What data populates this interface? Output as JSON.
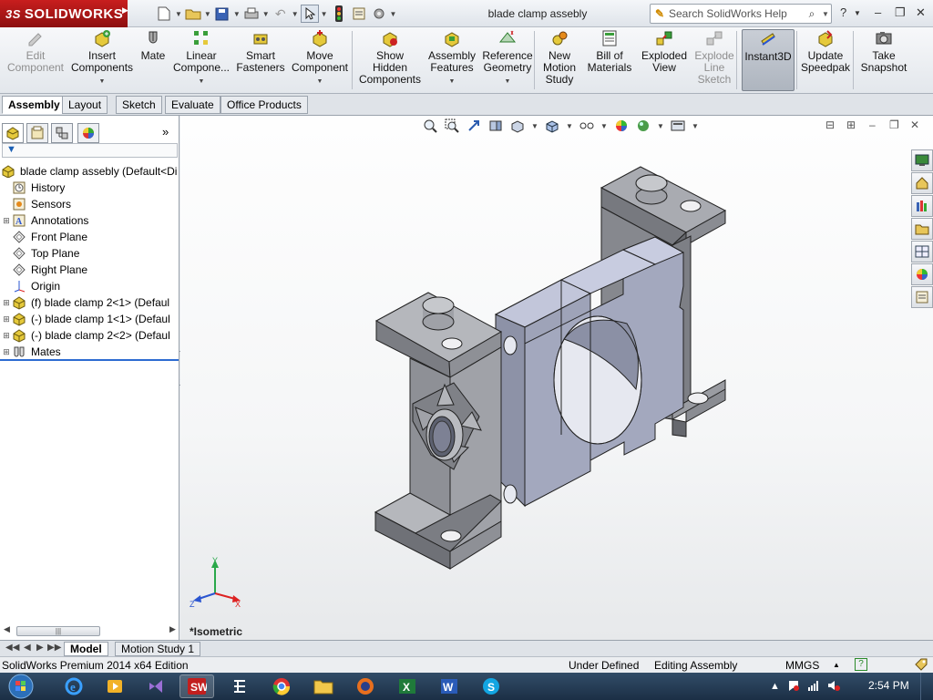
{
  "app": {
    "brand": "SOLIDWORKS",
    "brand_prefix": "3S",
    "document_title": "blade clamp assebly"
  },
  "search": {
    "placeholder": "Search SolidWorks Help"
  },
  "commands": [
    {
      "label": "Edit Component",
      "line1": "Edit",
      "line2": "Component",
      "disabled": true
    },
    {
      "label": "Insert Components",
      "line1": "Insert",
      "line2": "Components",
      "arrow": true
    },
    {
      "label": "Mate",
      "line1": "Mate",
      "line2": ""
    },
    {
      "label": "Linear Component Pattern",
      "line1": "Linear",
      "line2": "Compone...",
      "arrow": true
    },
    {
      "label": "Smart Fasteners",
      "line1": "Smart",
      "line2": "Fasteners"
    },
    {
      "label": "Move Component",
      "line1": "Move",
      "line2": "Component",
      "arrow": true
    },
    {
      "label": "Show Hidden Components",
      "line1": "Show",
      "line2": "Hidden",
      "line3": "Components"
    },
    {
      "label": "Assembly Features",
      "line1": "Assembly",
      "line2": "Features",
      "arrow": true
    },
    {
      "label": "Reference Geometry",
      "line1": "Reference",
      "line2": "Geometry",
      "arrow": true
    },
    {
      "label": "New Motion Study",
      "line1": "New",
      "line2": "Motion",
      "line3": "Study"
    },
    {
      "label": "Bill of Materials",
      "line1": "Bill of",
      "line2": "Materials"
    },
    {
      "label": "Exploded View",
      "line1": "Exploded",
      "line2": "View"
    },
    {
      "label": "Explode Line Sketch",
      "line1": "Explode",
      "line2": "Line",
      "line3": "Sketch",
      "disabled": true
    },
    {
      "label": "Instant3D",
      "line1": "Instant3D",
      "line2": "",
      "active": true
    },
    {
      "label": "Update Speedpak",
      "line1": "Update",
      "line2": "Speedpak"
    },
    {
      "label": "Take Snapshot",
      "line1": "Take",
      "line2": "Snapshot"
    }
  ],
  "tabs": [
    "Assembly",
    "Layout",
    "Sketch",
    "Evaluate",
    "Office Products"
  ],
  "tree": {
    "root": "blade clamp assebly  (Default<Di",
    "items": [
      {
        "label": "History",
        "expandable": false
      },
      {
        "label": "Sensors",
        "expandable": false
      },
      {
        "label": "Annotations",
        "expandable": true
      },
      {
        "label": "Front Plane",
        "expandable": false
      },
      {
        "label": "Top Plane",
        "expandable": false
      },
      {
        "label": "Right Plane",
        "expandable": false
      },
      {
        "label": "Origin",
        "expandable": false
      },
      {
        "label": "(f) blade clamp 2<1> (Defaul",
        "expandable": true
      },
      {
        "label": "(-) blade clamp 1<1> (Defaul",
        "expandable": true
      },
      {
        "label": "(-) blade clamp 2<2> (Defaul",
        "expandable": true
      },
      {
        "label": "Mates",
        "expandable": true
      }
    ]
  },
  "viewport": {
    "view_label": "*Isometric",
    "axes": {
      "x": "X",
      "y": "Y",
      "z": "Z"
    }
  },
  "bottom_tabs": [
    "Model",
    "Motion Study 1"
  ],
  "status": {
    "product": "SolidWorks Premium 2014 x64 Edition",
    "state": "Under Defined",
    "mode": "Editing Assembly",
    "units": "MMGS"
  },
  "taskbar": {
    "clock": "2:54 PM"
  },
  "colors": {
    "brand_red": "#b0191c",
    "part_face": "#8e9097",
    "part_top": "#bfc1c6",
    "clamp_face": "#a9aec4",
    "clamp_top": "#c9cde0",
    "tree_accent": "#2d6bd1"
  }
}
